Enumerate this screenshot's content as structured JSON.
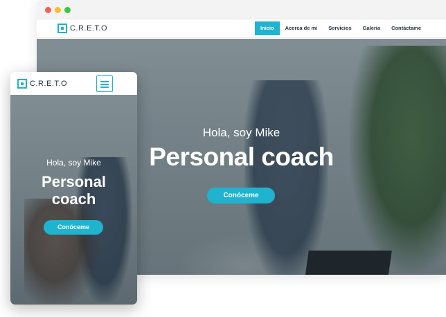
{
  "brand": {
    "name": "C.R.E.T.O",
    "color": "#1fb3cf"
  },
  "desktop": {
    "nav": {
      "items": [
        {
          "label": "Inicio",
          "active": true
        },
        {
          "label": "Acerca de mi",
          "active": false
        },
        {
          "label": "Servicios",
          "active": false
        },
        {
          "label": "Galeria",
          "active": false
        },
        {
          "label": "Contáctame",
          "active": false
        }
      ]
    },
    "hero": {
      "greeting": "Hola, soy Mike",
      "title": "Personal coach",
      "cta": "Conóceme"
    }
  },
  "mobile": {
    "menu_icon": "hamburger-menu-icon",
    "hero": {
      "greeting": "Hola, soy Mike",
      "title_line1": "Personal",
      "title_line2": "coach",
      "cta": "Conóceme"
    }
  }
}
